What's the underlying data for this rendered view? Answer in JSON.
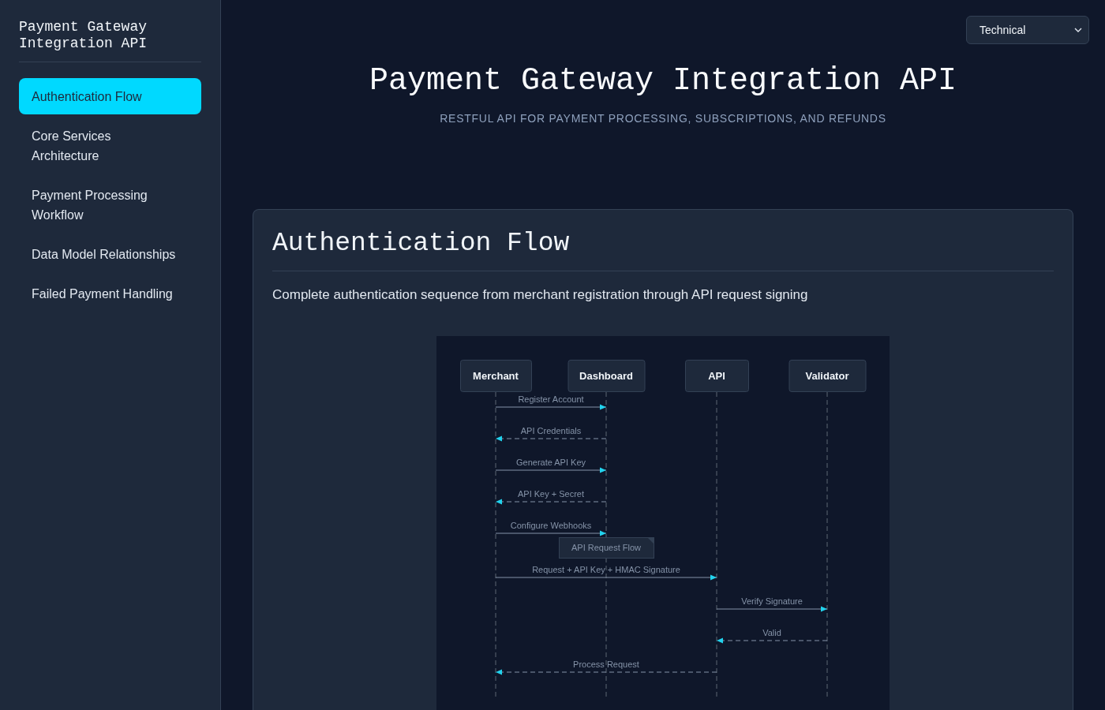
{
  "sidebar": {
    "title": "Payment Gateway Integration API",
    "items": [
      {
        "label": "Authentication Flow",
        "selected": true
      },
      {
        "label": "Core Services Architecture",
        "selected": false
      },
      {
        "label": "Payment Processing Workflow",
        "selected": false
      },
      {
        "label": "Data Model Relationships",
        "selected": false
      },
      {
        "label": "Failed Payment Handling",
        "selected": false
      }
    ]
  },
  "view_select": {
    "value": "Technical"
  },
  "header": {
    "title": "Payment Gateway Integration API",
    "subtitle": "RESTFUL API FOR PAYMENT PROCESSING, SUBSCRIPTIONS, AND REFUNDS"
  },
  "section": {
    "title": "Authentication Flow",
    "description": "Complete authentication sequence from merchant registration through API request signing",
    "diagram": {
      "participants": [
        {
          "name": "Merchant"
        },
        {
          "name": "Dashboard"
        },
        {
          "name": "API"
        },
        {
          "name": "Validator"
        }
      ],
      "steps": [
        {
          "kind": "request",
          "label": "Register Account",
          "lanes": [
            {
              "kind": "source"
            },
            {
              "kind": "target"
            },
            {
              "kind": "idle"
            },
            {
              "kind": "idle"
            }
          ]
        },
        {
          "kind": "reply",
          "label": "API Credentials",
          "lanes": [
            {
              "kind": "target"
            },
            {
              "kind": "source"
            },
            {
              "kind": "idle"
            },
            {
              "kind": "idle"
            }
          ]
        },
        {
          "kind": "request",
          "label": "Generate API Key",
          "lanes": [
            {
              "kind": "source"
            },
            {
              "kind": "target"
            },
            {
              "kind": "idle"
            },
            {
              "kind": "idle"
            }
          ]
        },
        {
          "kind": "reply",
          "label": "API Key + Secret",
          "lanes": [
            {
              "kind": "target"
            },
            {
              "kind": "source"
            },
            {
              "kind": "idle"
            },
            {
              "kind": "idle"
            }
          ]
        },
        {
          "kind": "request",
          "label": "Configure Webhooks",
          "lanes": [
            {
              "kind": "source"
            },
            {
              "kind": "target"
            },
            {
              "kind": "idle"
            },
            {
              "kind": "idle"
            }
          ]
        },
        {
          "kind": "note",
          "label": "API Request Flow",
          "lanes": [
            {
              "kind": "idle"
            },
            {
              "kind": "covered"
            },
            {
              "kind": "idle"
            },
            {
              "kind": "idle"
            }
          ]
        },
        {
          "kind": "request",
          "label": "Request + API Key + HMAC Signature",
          "lanes": [
            {
              "kind": "source"
            },
            {
              "kind": "idle"
            },
            {
              "kind": "target"
            },
            {
              "kind": "idle"
            }
          ]
        },
        {
          "kind": "request",
          "label": "Verify Signature",
          "lanes": [
            {
              "kind": "idle"
            },
            {
              "kind": "idle"
            },
            {
              "kind": "source"
            },
            {
              "kind": "target"
            }
          ]
        },
        {
          "kind": "reply",
          "label": "Valid",
          "lanes": [
            {
              "kind": "idle"
            },
            {
              "kind": "idle"
            },
            {
              "kind": "target"
            },
            {
              "kind": "source"
            }
          ]
        },
        {
          "kind": "reply",
          "label": "Process Request",
          "lanes": [
            {
              "kind": "target"
            },
            {
              "kind": "idle"
            },
            {
              "kind": "source"
            },
            {
              "kind": "idle"
            }
          ]
        }
      ]
    }
  }
}
